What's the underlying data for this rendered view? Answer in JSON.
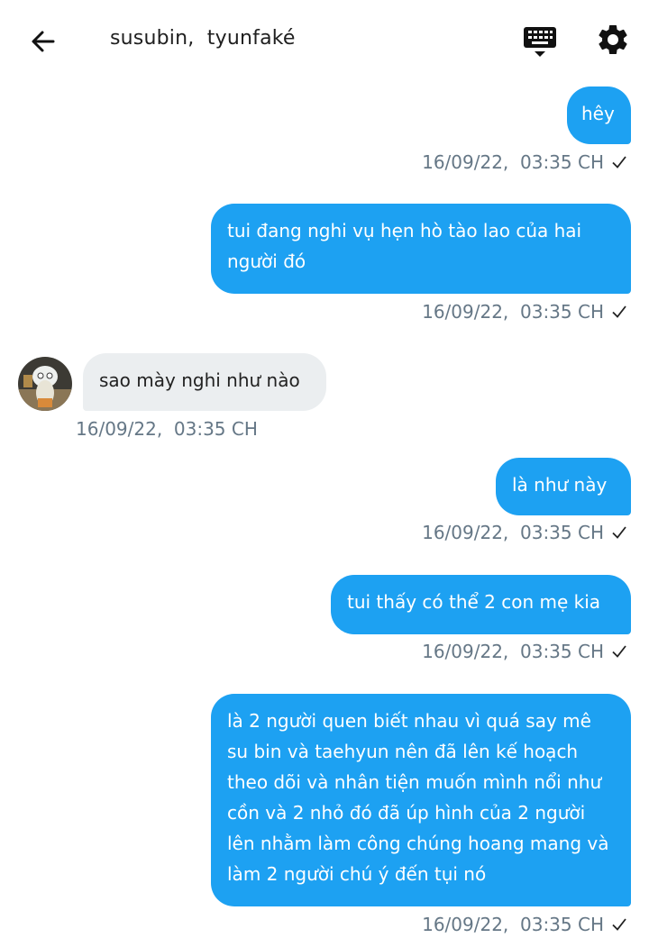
{
  "header": {
    "title": "susubin,  tyunfaké",
    "back_icon": "arrow-left-icon",
    "keyboard_icon": "keyboard-icon",
    "settings_icon": "gear-icon"
  },
  "colors": {
    "outgoing_bubble": "#1da1f2",
    "incoming_bubble": "#ebeef0",
    "timestamp": "#657786"
  },
  "messages": [
    {
      "direction": "outgoing",
      "text": "hêy",
      "timestamp": "16/09/22,  03:35 CH",
      "status_icon": "check-icon"
    },
    {
      "direction": "outgoing",
      "text": "tui đang nghi vụ hẹn hò tào lao của hai người đó",
      "timestamp": "16/09/22,  03:35 CH",
      "status_icon": "check-icon"
    },
    {
      "direction": "incoming",
      "text": "sao mày nghi như nào",
      "timestamp": "16/09/22,  03:35 CH",
      "avatar": "avatar"
    },
    {
      "direction": "outgoing",
      "text": "là như này",
      "timestamp": "16/09/22,  03:35 CH",
      "status_icon": "check-icon"
    },
    {
      "direction": "outgoing",
      "text": "tui thấy có thể 2 con mẹ kia",
      "timestamp": "16/09/22,  03:35 CH",
      "status_icon": "check-icon"
    },
    {
      "direction": "outgoing",
      "text": "là 2 người quen biết nhau vì quá say mê su bin và taehyun nên đã lên kế hoạch theo dõi và nhân tiện muốn mình nổi như cồn và 2 nhỏ đó đã úp hình của 2 người lên nhằm làm công chúng hoang mang và làm 2 người chú ý đến tụi nó",
      "timestamp": "16/09/22,  03:35 CH",
      "status_icon": "check-icon"
    }
  ]
}
